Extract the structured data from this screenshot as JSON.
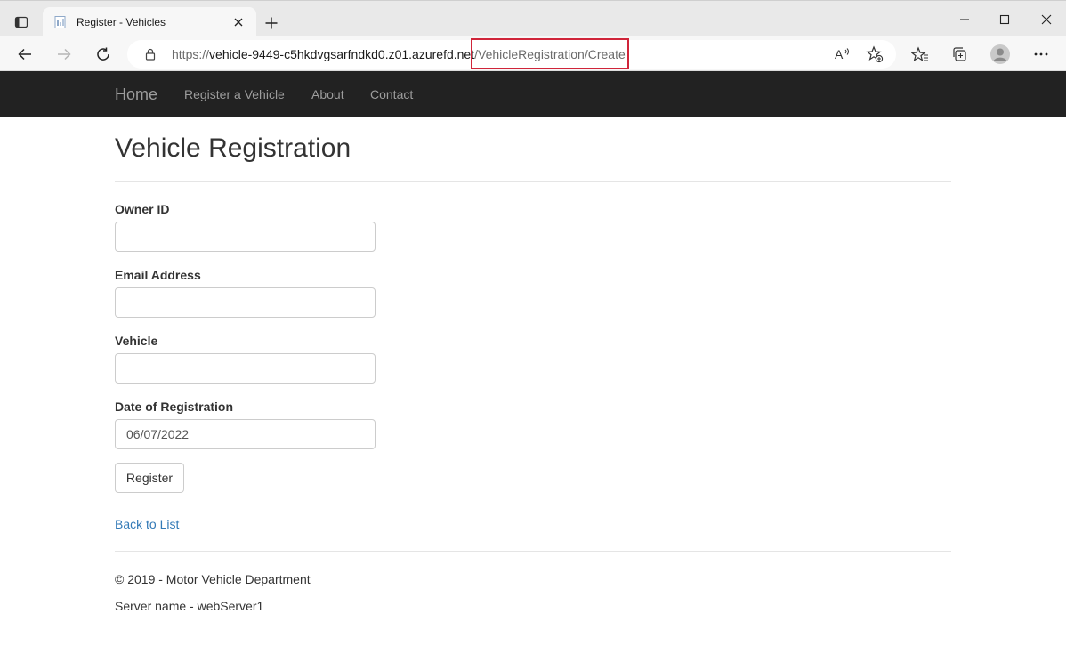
{
  "browser": {
    "tab_title": "Register - Vehicles",
    "url_scheme": "https://",
    "url_host": "vehicle-9449-c5hkdvgsarfndkd0.z01.azurefd.net",
    "url_path": "/VehicleRegistration/Create",
    "highlight_color": "#d0253a"
  },
  "nav": {
    "brand": "Home",
    "links": [
      "Register a Vehicle",
      "About",
      "Contact"
    ],
    "background": "#222222"
  },
  "page": {
    "title": "Vehicle Registration"
  },
  "form": {
    "owner_id_label": "Owner ID",
    "owner_id_value": "",
    "email_label": "Email Address",
    "email_value": "",
    "vehicle_label": "Vehicle",
    "vehicle_value": "",
    "date_label": "Date of Registration",
    "date_value": "06/07/2022",
    "submit_label": "Register"
  },
  "back_link": "Back to List",
  "footer": {
    "copyright": "© 2019 - Motor Vehicle Department",
    "server": "Server name - webServer1"
  },
  "icons": [
    "tab-actions-icon",
    "favicon-icon",
    "close-icon",
    "plus-icon",
    "minimize-icon",
    "maximize-icon",
    "window-close-icon",
    "back-arrow-icon",
    "forward-arrow-icon",
    "refresh-icon",
    "lock-icon",
    "read-aloud-icon",
    "add-favorite-icon",
    "favorites-icon",
    "collections-icon",
    "profile-icon",
    "more-icon"
  ]
}
